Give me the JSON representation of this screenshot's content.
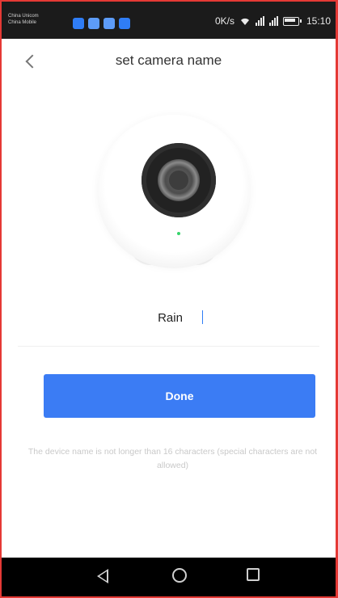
{
  "status_bar": {
    "carrier_1": "China Unicom",
    "carrier_2": "China Mobile",
    "net_speed": "0K/s",
    "time": "15:10"
  },
  "header": {
    "title": "set camera name"
  },
  "form": {
    "name_value": "Rain",
    "done_label": "Done",
    "hint": "The device name is not longer than 16 characters (special characters are not allowed)"
  },
  "colors": {
    "accent": "#3b7cf4",
    "led": "#37d46b",
    "frame_border": "#e53935"
  },
  "icons": {
    "back": "chevron-left-icon",
    "nav_back": "triangle-back-icon",
    "nav_home": "circle-home-icon",
    "nav_recent": "square-recent-icon"
  }
}
